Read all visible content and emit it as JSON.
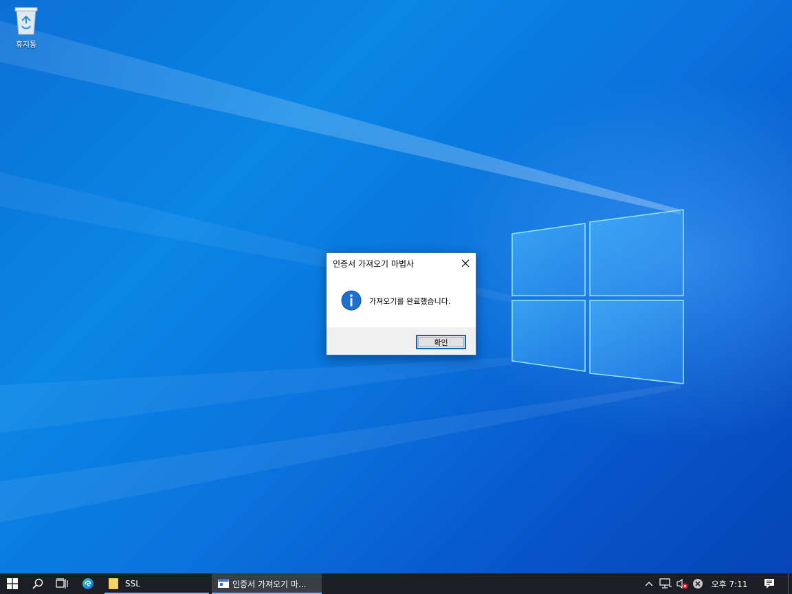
{
  "desktop": {
    "icons": [
      {
        "label": "휴지통",
        "icon": "recycle-bin-icon"
      }
    ]
  },
  "dialog": {
    "title": "인증서 가져오기 마법사",
    "message": "가져오기를 완료했습니다.",
    "ok_label": "확인",
    "icon": "info-icon"
  },
  "taskbar": {
    "start_icon": "windows-start-icon",
    "search_icon": "search-icon",
    "task_view_icon": "task-view-icon",
    "edge_icon": "edge-icon",
    "tasks": [
      {
        "label": "SSL",
        "icon": "folder-icon"
      },
      {
        "label": "인증서 가져오기 마...",
        "icon": "dialog-window-icon"
      }
    ],
    "tray": {
      "chevron_icon": "chevron-up-icon",
      "network_icon": "network-icon",
      "volume_icon": "volume-muted-icon",
      "error_icon": "error-icon",
      "clock": "오후 7:11",
      "notification_icon": "notification-icon"
    }
  },
  "colors": {
    "taskbar_bg": "#1c1e24",
    "accent": "#0a64c8",
    "active_indicator": "#76b9ed"
  }
}
